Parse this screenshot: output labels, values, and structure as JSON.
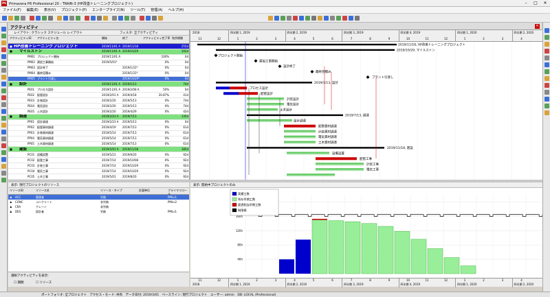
{
  "window": {
    "title": "Primavera P6 Professional 20 : TRAIN-3 (HP改善トレーニングプロジェクト)",
    "app_icon": "P6"
  },
  "menu": [
    "ファイル(F)",
    "編集(E)",
    "表示(V)",
    "プロジェクト(P)",
    "エンタープライズ(N)",
    "ツール(T)",
    "管理(A)",
    "ヘルプ(H)"
  ],
  "activities_panel": {
    "title": "アクティビティ",
    "layout_label": "レイアウト: クラシック スケジュール レイアウト",
    "filter_label": "フィルタ: 全アクティビティ"
  },
  "columns": {
    "id": "アクティビティID",
    "name": "アクティビティ名",
    "start": "開始",
    "finish": "終了",
    "complete": "アクティビティ完了率",
    "total_float": "残余期間"
  },
  "rows": [
    {
      "level": 0,
      "id": "",
      "name": "HP改善トレーニングプロジェクト",
      "start": "2019/11/01 A",
      "finish": "2019/11/18",
      "complete": "",
      "tf": "255d"
    },
    {
      "level": 1,
      "id": "",
      "name": "マイルストン",
      "start": "2019/11/01 A",
      "finish": "2019/10/29",
      "complete": "",
      "tf": "102d"
    },
    {
      "level": 2,
      "id": "PM01",
      "name": "プロジェクト開始",
      "start": "2019/11/01 A",
      "finish": "",
      "complete": "100%",
      "tf": "0d"
    },
    {
      "level": 2,
      "id": "PM02",
      "name": "建設工事開始",
      "start": "2019/5/01*",
      "finish": "",
      "complete": "0%",
      "tf": "0d"
    },
    {
      "level": 2,
      "id": "PM03",
      "name": "設計終了",
      "start": "",
      "finish": "2019/1/31*",
      "complete": "0%",
      "tf": "0d"
    },
    {
      "level": 2,
      "id": "PM04",
      "name": "最終見積み",
      "start": "",
      "finish": "2019/1/31*",
      "complete": "0%",
      "tf": "0d"
    },
    {
      "level": 2,
      "id": "PM05",
      "name": "プラント引渡し",
      "start": "",
      "finish": "2019/10/29*",
      "complete": "0%",
      "tf": "0d",
      "selected": true
    },
    {
      "level": 1,
      "id": "",
      "name": "設計",
      "start": "2019/11/01 A",
      "finish": "2019/1/13",
      "complete": "",
      "tf": "74d"
    },
    {
      "level": 2,
      "id": "PE01",
      "name": "プロセス設計",
      "start": "2019/11/01 A",
      "finish": "2019/2/08 A",
      "complete": "50%",
      "tf": "0d"
    },
    {
      "level": 2,
      "id": "PE02",
      "name": "配管設計",
      "start": "2019/2/01 A",
      "finish": "2019/4/18",
      "complete": "20.87%",
      "tf": "41d"
    },
    {
      "level": 2,
      "id": "PE03",
      "name": "計装設計",
      "start": "2019/2/20",
      "finish": "2019/5/13",
      "complete": "0%",
      "tf": "74d"
    },
    {
      "level": 2,
      "id": "PE04",
      "name": "電気設計",
      "start": "2019/2/20",
      "finish": "2019/5/13",
      "complete": "0%",
      "tf": "74d"
    },
    {
      "level": 2,
      "id": "PE05",
      "name": "土木設計",
      "start": "2019/2/20",
      "finish": "2019/4/29",
      "complete": "0%",
      "tf": "42d"
    },
    {
      "level": 1,
      "id": "",
      "name": "調達",
      "start": "2019/2/23 A",
      "finish": "2019/7/13",
      "complete": "",
      "tf": "135d"
    },
    {
      "level": 2,
      "id": "PP01",
      "name": "設計調達",
      "start": "2019/2/23 A",
      "finish": "2019/5/13",
      "complete": "0%",
      "tf": "0d"
    },
    {
      "level": 2,
      "id": "PP02",
      "name": "配管資材調達",
      "start": "2019/4/19",
      "finish": "2019/7/13",
      "complete": "0%",
      "tf": "61d"
    },
    {
      "level": 2,
      "id": "PP03",
      "name": "計装資材調達",
      "start": "2019/5/14",
      "finish": "2019/7/13",
      "complete": "0%",
      "tf": "61d"
    },
    {
      "level": 2,
      "id": "PP04",
      "name": "電気資材調達",
      "start": "2019/5/14",
      "finish": "2019/7/13",
      "complete": "0%",
      "tf": "61d"
    },
    {
      "level": 2,
      "id": "PP05",
      "name": "土木資材調達",
      "start": "2019/5/14",
      "finish": "2019/7/13",
      "complete": "0%",
      "tf": "61d"
    },
    {
      "level": 1,
      "id": "",
      "name": "建設",
      "start": "2019/5/01 A",
      "finish": "2019/11/18",
      "complete": "",
      "tf": "185d"
    },
    {
      "level": 2,
      "id": "PC01",
      "name": "設備設置",
      "start": "2019/5/21",
      "finish": "2019/9/20",
      "complete": "0%",
      "tf": "92d"
    },
    {
      "level": 2,
      "id": "PC02",
      "name": "配管工事",
      "start": "2019/7/14",
      "finish": "2019/10/08",
      "complete": "0%",
      "tf": "92d"
    },
    {
      "level": 2,
      "id": "PC03",
      "name": "計装工事",
      "start": "2019/7/14",
      "finish": "2019/10/29",
      "complete": "0%",
      "tf": "92d"
    },
    {
      "level": 2,
      "id": "PC04",
      "name": "電気工事",
      "start": "2019/7/14",
      "finish": "2019/10/29",
      "complete": "0%",
      "tf": "92d"
    },
    {
      "level": 2,
      "id": "PC05",
      "name": "土木工事",
      "start": "2019/5/01",
      "finish": "2019/8/20",
      "complete": "0%",
      "tf": "92d"
    }
  ],
  "timeline": {
    "years": [
      "2018",
      "四半期 1, 2019",
      "四半期 2, 2019",
      "四半期 3, 2019",
      "四半期 4, 2019",
      "四半期 1, 2020",
      "四半期 2, 2020"
    ],
    "months": [
      "11",
      "12",
      "1",
      "2",
      "3",
      "4",
      "5",
      "6",
      "7",
      "8",
      "9",
      "10",
      "11",
      "12",
      "1",
      "2",
      "3",
      "4"
    ]
  },
  "gantt_labels": [
    {
      "text": "2019/11/18, HP改善トレーニングプロジェクト"
    },
    {
      "text": "2019/10/29, マイルストン"
    },
    {
      "text": "プロジェクト開始"
    },
    {
      "text": "建設工事開始"
    },
    {
      "text": "設計終了"
    },
    {
      "text": "最終見積み"
    },
    {
      "text": "プラント引渡し"
    },
    {
      "text": "2019/1/13, 設計"
    },
    {
      "text": "プロセス設計"
    },
    {
      "text": "配管設計"
    },
    {
      "text": "計装設計"
    },
    {
      "text": "電気設計"
    },
    {
      "text": "土木設計"
    },
    {
      "text": "2019/7/13, 調達"
    },
    {
      "text": "設計調達"
    },
    {
      "text": "配管資材調達"
    },
    {
      "text": "計装資材調達"
    },
    {
      "text": "電気資材調達"
    },
    {
      "text": "土木資材調達"
    },
    {
      "text": "2019/11/18, 建設"
    },
    {
      "text": "設備設置"
    },
    {
      "text": "配管工事"
    },
    {
      "text": "計装工事"
    },
    {
      "text": "電気工事"
    }
  ],
  "resources_panel": {
    "toolbar": "表示: 現行プロジェクトのリソース",
    "columns": [
      "リソースID",
      "リソース名",
      "リソース・タイプ",
      "計量単位",
      "プライマリロール"
    ],
    "rows": [
      {
        "id": "ACC",
        "name": "管理者",
        "type": "労務",
        "unit": "",
        "role": "PMLv1",
        "selected": true
      },
      {
        "id": "CONC",
        "name": "コンクリート",
        "type": "非労務",
        "unit": "",
        "role": "PMLv2"
      },
      {
        "id": "CRA",
        "name": "クレーン",
        "type": "非労務",
        "unit": "",
        "role": ""
      },
      {
        "id": "DES",
        "name": "設計者",
        "type": "労務",
        "unit": "",
        "role": "PMLv1"
      }
    ],
    "footer_label": "選択アクティビティを表示:",
    "check_1": "期間",
    "check_2": "リソース"
  },
  "histogram": {
    "toolbar": "表示: 開始中プロジェクトのみ",
    "legend": [
      "実績工数",
      "残存早期工数",
      "超過割当早期工数",
      "制限値"
    ],
    "yaxis": [
      "200h",
      "160h",
      "120h",
      "80h",
      "40h"
    ],
    "colors": {
      "actual": "#0000cc",
      "remaining": "#99ee99",
      "over": "#cc0000",
      "limit": "#000000"
    },
    "months": [
      "11",
      "12",
      "1",
      "2",
      "3",
      "4",
      "5",
      "6",
      "7",
      "8",
      "9",
      "10",
      "11",
      "12",
      "1",
      "2",
      "3",
      "4"
    ],
    "years": [
      "2018",
      "四半期 1, 2019",
      "四半期 2, 2019",
      "四半期 3, 2019",
      "四半期 4, 2019",
      "四半期 1, 2020",
      "四半期 2, 2020"
    ],
    "bars": [
      {
        "m": 2,
        "actual": 40
      },
      {
        "m": 3,
        "actual": 95
      },
      {
        "m": 4,
        "remaining": 150,
        "over": 0
      },
      {
        "m": 5,
        "remaining": 148
      },
      {
        "m": 6,
        "remaining": 145
      },
      {
        "m": 7,
        "remaining": 140
      },
      {
        "m": 8,
        "remaining": 132
      },
      {
        "m": 9,
        "remaining": 118
      },
      {
        "m": 10,
        "remaining": 96
      },
      {
        "m": 11,
        "remaining": 70
      },
      {
        "m": 12,
        "remaining": 45
      },
      {
        "m": 13,
        "remaining": 22
      }
    ]
  },
  "statusbar": "ポートフォリオ: 全プロジェクト　アクセス・モード: 共有　データ日付: 2019/3/01　ベースライン: 現行プロジェクト　ユーザー: admin　DB: LOCAL (Professional)"
}
